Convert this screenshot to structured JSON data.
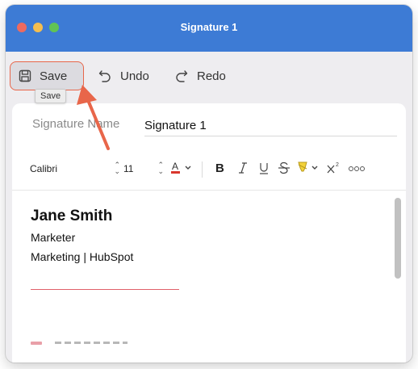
{
  "window": {
    "title": "Signature 1"
  },
  "toolbar": {
    "save_label": "Save",
    "undo_label": "Undo",
    "redo_label": "Redo",
    "save_tooltip": "Save"
  },
  "signature_name": {
    "label": "Signature Name",
    "value": "Signature 1"
  },
  "format": {
    "font": "Calibri",
    "size": "11"
  },
  "signature": {
    "name": "Jane Smith",
    "title": "Marketer",
    "company": "Marketing | HubSpot"
  },
  "colors": {
    "titlebar": "#3d7bd5",
    "highlight": "#e8664a",
    "font_color_bar": "#d9372d",
    "highlighter_yellow": "#f3d23a"
  },
  "icons": {
    "save": "floppy-disk-icon",
    "undo": "undo-icon",
    "redo": "redo-icon",
    "font_color": "font-color-icon",
    "bold": "bold-icon",
    "italic": "italic-icon",
    "underline": "underline-icon",
    "strikethrough": "strikethrough-icon",
    "highlight": "highlighter-icon",
    "superscript": "superscript-icon",
    "more": "more-icon"
  }
}
